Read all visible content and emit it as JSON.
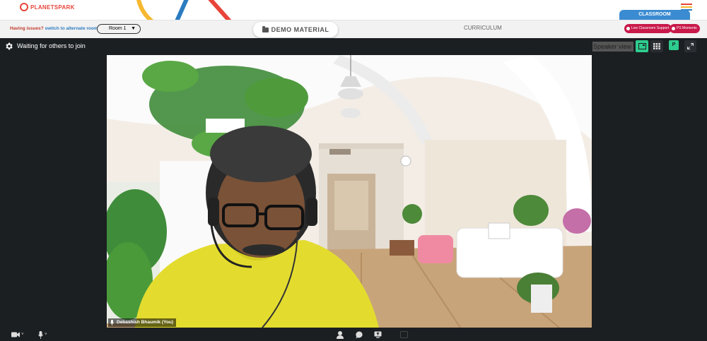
{
  "brand": {
    "name": "PLANETSPARK"
  },
  "header": {
    "classroom_tab": "CLASSROOM",
    "menu_icon": "hamburger-icon"
  },
  "subbar": {
    "issues_text": "Having issues?",
    "alternate_link": "switch to alternate room",
    "room_selected": "Room 1",
    "demo_button": "DEMO MATERIAL",
    "curriculum": "CURRICULUM",
    "support_button": "Live Classroom Support",
    "moments_button": "PS Moments"
  },
  "meeting": {
    "status": "Waiting for others to join",
    "speaker_view": "Speaker view",
    "participant_badge": "P",
    "participant_name": "Debashish Bhaumik (You)"
  },
  "colors": {
    "accent": "#2ecc8e",
    "brand_red": "#c8194a",
    "classroom_blue": "#3a8bd1",
    "meeting_bg": "#1c1f22"
  }
}
